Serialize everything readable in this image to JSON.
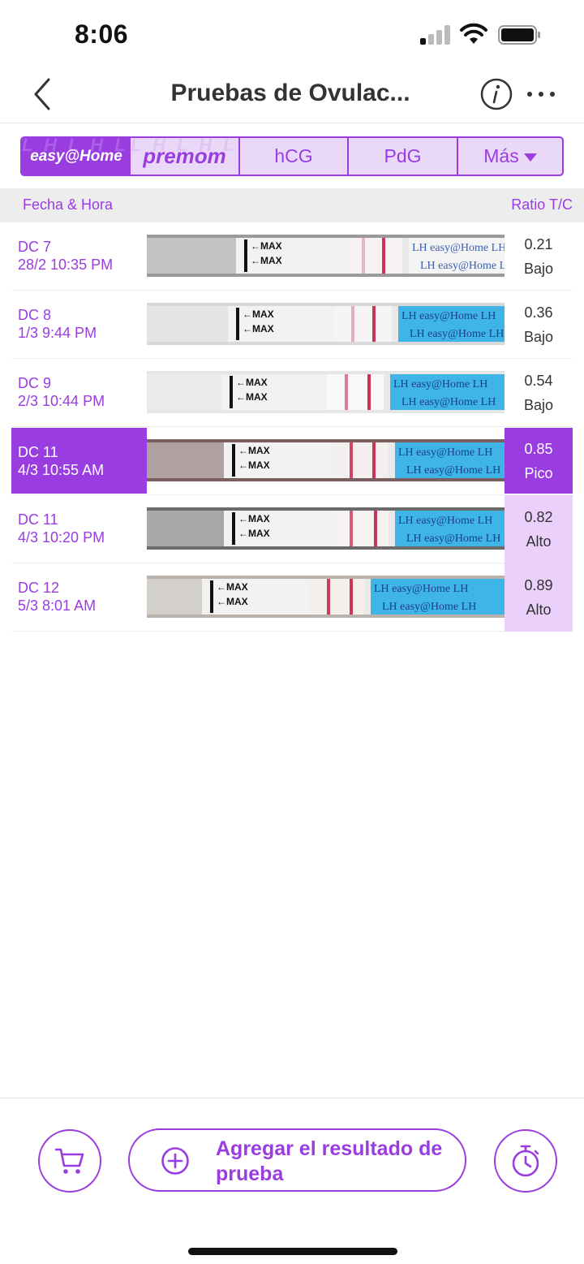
{
  "status_bar": {
    "time": "8:06"
  },
  "nav": {
    "title": "Pruebas de Ovulac..."
  },
  "brand_tabs": {
    "easyhome": "easy@Home",
    "premom": "premom",
    "hcg": "hCG",
    "pdg": "PdG",
    "mas": "Más"
  },
  "columns": {
    "date": "Fecha & Hora",
    "ratio": "Ratio T/C"
  },
  "rows": [
    {
      "dc": "DC 7",
      "datetime": "28/2 10:35 PM",
      "ratio": "0.21",
      "level": "Bajo"
    },
    {
      "dc": "DC 8",
      "datetime": "1/3 9:44 PM",
      "ratio": "0.36",
      "level": "Bajo"
    },
    {
      "dc": "DC 9",
      "datetime": "2/3 10:44 PM",
      "ratio": "0.54",
      "level": "Bajo"
    },
    {
      "dc": "DC 11",
      "datetime": "4/3 10:55 AM",
      "ratio": "0.85",
      "level": "Pico"
    },
    {
      "dc": "DC 11",
      "datetime": "4/3 10:20 PM",
      "ratio": "0.82",
      "level": "Alto"
    },
    {
      "dc": "DC 12",
      "datetime": "5/3 8:01 AM",
      "ratio": "0.89",
      "level": "Alto"
    }
  ],
  "strip_labels": {
    "max": "MAX",
    "lh": "LH",
    "brand": "easy@Home"
  },
  "bottom": {
    "add_label": "Agregar el resultado de prueba"
  },
  "icons": [
    "back-chevron-icon",
    "info-icon",
    "more-dots-icon",
    "cart-icon",
    "plus-circle-icon",
    "timer-icon"
  ],
  "colors": {
    "accent": "#9a3de0",
    "accent_light": "#ead0fa",
    "strip_blue": "#3fb4e6",
    "test_line": "#c8284f"
  }
}
